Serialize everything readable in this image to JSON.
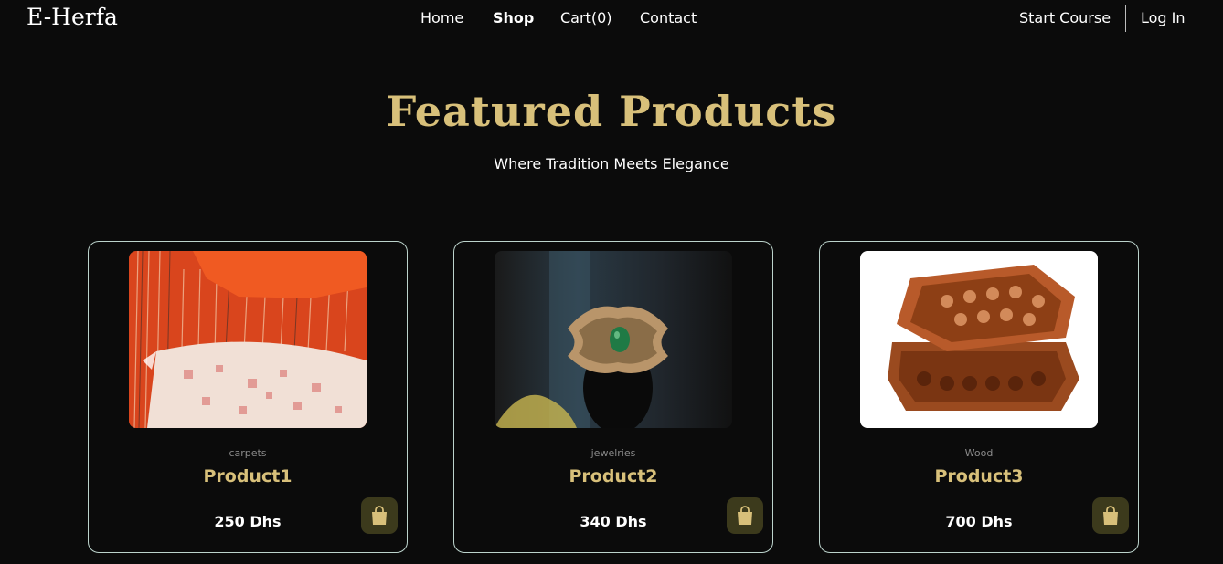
{
  "nav": {
    "logo": "E-Herfa",
    "links": [
      "Home",
      "Shop",
      "Cart(0)",
      "Contact"
    ],
    "active": "Shop",
    "start_course": "Start Course",
    "login": "Log In"
  },
  "hero": {
    "title": "Featured Products",
    "subtitle": "Where Tradition Meets Elegance"
  },
  "products": [
    {
      "category": "carpets",
      "name": "Product1",
      "price": "250 Dhs"
    },
    {
      "category": "jewelries",
      "name": "Product2",
      "price": "340 Dhs"
    },
    {
      "category": "Wood",
      "name": "Product3",
      "price": "700 Dhs"
    }
  ],
  "colors": {
    "background": "#0b0b0b",
    "accent_gold": "#d8c07a",
    "card_border": "#bcd3cc",
    "cart_button": "#3c3a1c"
  },
  "icons": {
    "cart": "shopping-bag-icon"
  }
}
